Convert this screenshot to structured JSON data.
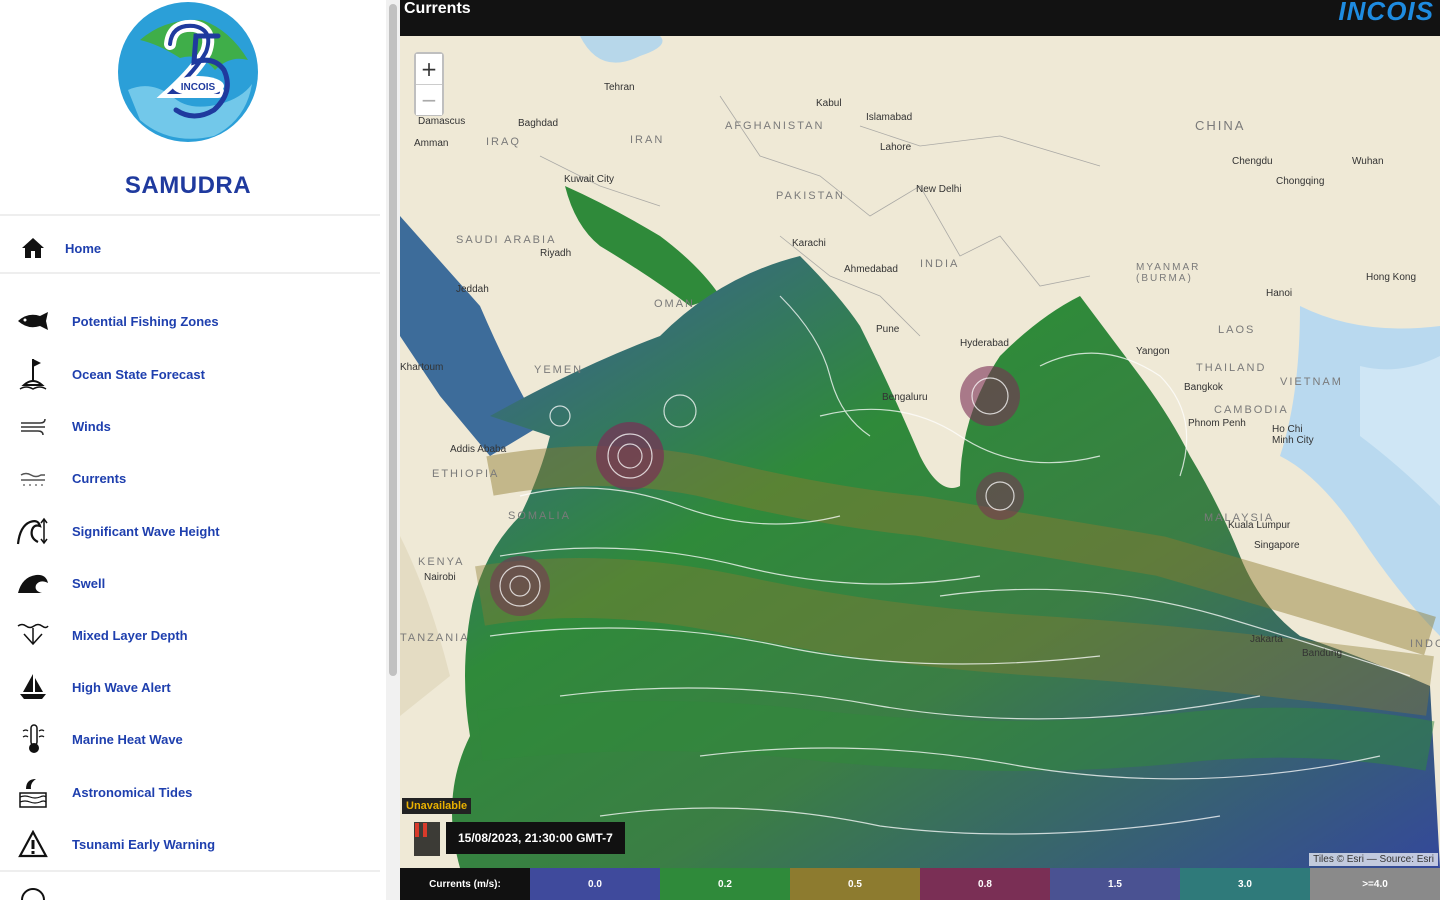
{
  "sidebar": {
    "brand": "SAMUDRA",
    "logo_text": "INCOIS",
    "items": [
      {
        "label": "Home",
        "icon": "home-icon"
      },
      {
        "label": "Potential Fishing Zones",
        "icon": "fish-icon"
      },
      {
        "label": "Ocean State Forecast",
        "icon": "buoy-flag-icon"
      },
      {
        "label": "Winds",
        "icon": "wind-icon"
      },
      {
        "label": "Currents",
        "icon": "currents-icon"
      },
      {
        "label": "Significant Wave Height",
        "icon": "wave-height-icon"
      },
      {
        "label": "Swell",
        "icon": "swell-icon"
      },
      {
        "label": "Mixed Layer Depth",
        "icon": "mixed-layer-icon"
      },
      {
        "label": "High Wave Alert",
        "icon": "boat-alert-icon"
      },
      {
        "label": "Marine Heat Wave",
        "icon": "thermometer-icon"
      },
      {
        "label": "Astronomical Tides",
        "icon": "tides-icon"
      },
      {
        "label": "Tsunami Early Warning",
        "icon": "warning-triangle-icon"
      }
    ]
  },
  "header": {
    "title": "Currents",
    "brand": "INCOIS"
  },
  "map": {
    "zoom_in": "+",
    "zoom_out": "−",
    "status": "Unavailable",
    "timestamp": "15/08/2023, 21:30:00 GMT-7",
    "attribution": "Tiles © Esri — Source: Esri",
    "places": [
      {
        "name": "Tehran"
      },
      {
        "name": "Kabul"
      },
      {
        "name": "AFGHANISTAN"
      },
      {
        "name": "CHINA"
      },
      {
        "name": "Damascus"
      },
      {
        "name": "Baghdad"
      },
      {
        "name": "Amman"
      },
      {
        "name": "IRAQ"
      },
      {
        "name": "IRAN"
      },
      {
        "name": "Islamabad"
      },
      {
        "name": "Lahore"
      },
      {
        "name": "Chengdu"
      },
      {
        "name": "Wuhan"
      },
      {
        "name": "Chongqing"
      },
      {
        "name": "New Delhi"
      },
      {
        "name": "PAKISTAN"
      },
      {
        "name": "Kuwait City"
      },
      {
        "name": "SAUDI ARABIA"
      },
      {
        "name": "Riyadh"
      },
      {
        "name": "Karachi"
      },
      {
        "name": "Ahmedabad"
      },
      {
        "name": "INDIA"
      },
      {
        "name": "MYANMAR (BURMA)"
      },
      {
        "name": "Hong Kong"
      },
      {
        "name": "Jeddah"
      },
      {
        "name": "OMAN"
      },
      {
        "name": "Hanoi"
      },
      {
        "name": "Pune"
      },
      {
        "name": "Hyderabad"
      },
      {
        "name": "LAOS"
      },
      {
        "name": "Yangon"
      },
      {
        "name": "THAILAND"
      },
      {
        "name": "Bangkok"
      },
      {
        "name": "VIETNAM"
      },
      {
        "name": "YEMEN"
      },
      {
        "name": "Bengaluru"
      },
      {
        "name": "CAMBODIA"
      },
      {
        "name": "Phnom Penh"
      },
      {
        "name": "Ho Chi Minh City"
      },
      {
        "name": "Addis Ababa"
      },
      {
        "name": "ETHIOPIA"
      },
      {
        "name": "SOMALIA"
      },
      {
        "name": "MALAYSIA"
      },
      {
        "name": "Kuala Lumpur"
      },
      {
        "name": "Singapore"
      },
      {
        "name": "KENYA"
      },
      {
        "name": "Nairobi"
      },
      {
        "name": "TANZANIA"
      },
      {
        "name": "Jakarta"
      },
      {
        "name": "Bandung"
      },
      {
        "name": "INDO"
      },
      {
        "name": "Khartoum"
      }
    ]
  },
  "legend": {
    "label": "Currents (m/s):",
    "bins": [
      {
        "label": "0.0",
        "color": "#3f4a9c"
      },
      {
        "label": "0.2",
        "color": "#2f8a3a"
      },
      {
        "label": "0.5",
        "color": "#8d7b2f"
      },
      {
        "label": "0.8",
        "color": "#7a2f55"
      },
      {
        "label": "1.5",
        "color": "#4a5292"
      },
      {
        "label": "3.0",
        "color": "#2f7a7a"
      },
      {
        "label": ">=4.0",
        "color": "#8a8a8a"
      }
    ]
  }
}
